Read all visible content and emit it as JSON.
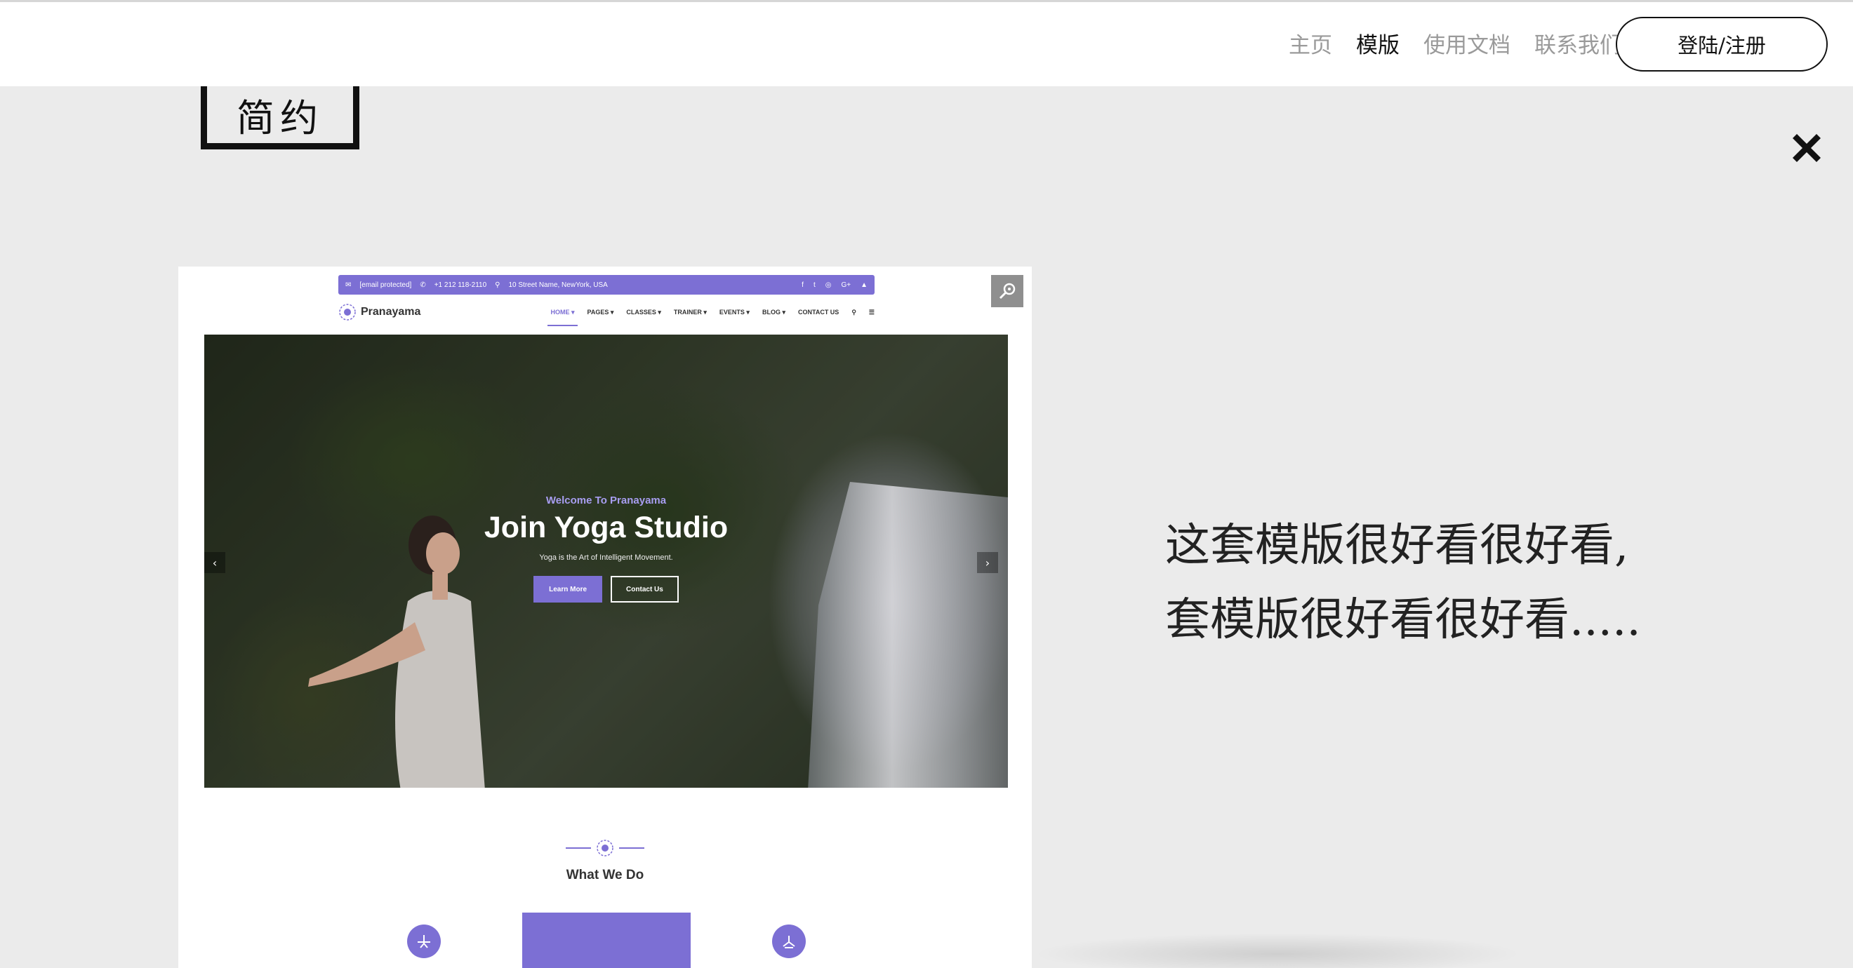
{
  "header": {
    "nav": [
      "主页",
      "模版",
      "使用文档",
      "联系我们"
    ],
    "active_nav": "模版",
    "login_label": "登陆/注册"
  },
  "category_tag": "简约",
  "preview": {
    "topbar": {
      "email": "[email protected]",
      "phone": "+1 212 118-2110",
      "address": "10 Street Name, NewYork, USA",
      "social_icons": [
        "f",
        "t",
        "◎",
        "G+",
        "▲"
      ]
    },
    "brand": "Pranayama",
    "menu": [
      "HOME ▾",
      "PAGES ▾",
      "CLASSES ▾",
      "TRAINER ▾",
      "EVENTS ▾",
      "BLOG ▾",
      "CONTACT US",
      "⚲",
      "☰"
    ],
    "hero": {
      "eyebrow": "Welcome To Pranayama",
      "title": "Join Yoga Studio",
      "subtitle": "Yoga is the Art of Intelligent Movement.",
      "primary_button": "Learn More",
      "secondary_button": "Contact Us",
      "prev": "‹",
      "next": "›"
    },
    "section_title": "What We Do"
  },
  "description": {
    "line1": "这套模版很好看很好看,",
    "line2": "套模版很好看很好看....."
  },
  "colors": {
    "accent": "#7c6fd4",
    "background": "#ebebeb"
  }
}
